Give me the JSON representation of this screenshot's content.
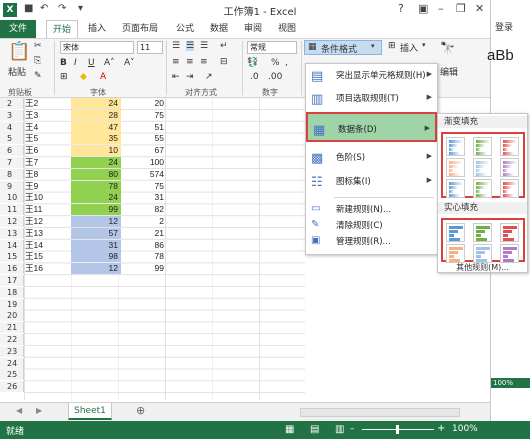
{
  "window": {
    "title": "工作簿1 - Excel",
    "help": "?",
    "login": "登录"
  },
  "ribbon_tabs": [
    "文件",
    "开始",
    "插入",
    "页面布局",
    "公式",
    "数据",
    "审阅",
    "视图"
  ],
  "ribbon": {
    "paste": "粘贴",
    "font_name": "宋体",
    "font_size": "11",
    "number_format": "常规",
    "conditional_format": "条件格式",
    "insert": "插入",
    "edit": "编辑",
    "style_preview": "aBb",
    "groups": {
      "clipboard": "剪贴板",
      "font": "字体",
      "alignment": "对齐方式",
      "number": "数字"
    }
  },
  "rows": [
    {
      "num": "2",
      "name": "王2",
      "b": "24",
      "c": "20"
    },
    {
      "num": "3",
      "name": "王3",
      "b": "28",
      "c": "75"
    },
    {
      "num": "4",
      "name": "王4",
      "b": "47",
      "c": "51"
    },
    {
      "num": "5",
      "name": "王5",
      "b": "35",
      "c": "55"
    },
    {
      "num": "6",
      "name": "王6",
      "b": "10",
      "c": "67"
    },
    {
      "num": "7",
      "name": "王7",
      "b": "24",
      "c": "100"
    },
    {
      "num": "8",
      "name": "王8",
      "b": "80",
      "c": "574"
    },
    {
      "num": "9",
      "name": "王9",
      "b": "78",
      "c": "75"
    },
    {
      "num": "10",
      "name": "王10",
      "b": "24",
      "c": "31"
    },
    {
      "num": "11",
      "name": "王11",
      "b": "99",
      "c": "82"
    },
    {
      "num": "12",
      "name": "王12",
      "b": "12",
      "c": "2"
    },
    {
      "num": "13",
      "name": "王13",
      "b": "57",
      "c": "21"
    },
    {
      "num": "14",
      "name": "王14",
      "b": "31",
      "c": "86"
    },
    {
      "num": "15",
      "name": "王15",
      "b": "98",
      "c": "78"
    },
    {
      "num": "16",
      "name": "王16",
      "b": "12",
      "c": "99"
    }
  ],
  "empty_rows": [
    "17",
    "18",
    "19",
    "20",
    "21",
    "22",
    "23",
    "24",
    "25",
    "26"
  ],
  "row_colors": {
    "yellow": "#ffe699",
    "green": "#92d050",
    "blue": "#b4c6e7"
  },
  "menu": {
    "items": [
      {
        "label": "突出显示单元格规则(H)",
        "icon": "highlight-rules-icon"
      },
      {
        "label": "项目选取规则(T)",
        "icon": "top-bottom-rules-icon"
      },
      {
        "label": "数据条(D)",
        "icon": "data-bars-icon"
      },
      {
        "label": "色阶(S)",
        "icon": "color-scales-icon"
      },
      {
        "label": "图标集(I)",
        "icon": "icon-sets-icon"
      },
      {
        "label": "新建规则(N)...",
        "icon": "new-rule-icon"
      },
      {
        "label": "清除规则(C)",
        "icon": "clear-rules-icon"
      },
      {
        "label": "管理规则(R)...",
        "icon": "manage-rules-icon"
      }
    ]
  },
  "submenu": {
    "gradient_fill": "渐变填充",
    "solid_fill": "实心填充",
    "more_rules": "其他规则(M)...",
    "bar_colors": [
      "#5b9bd5",
      "#70ad47",
      "#e05050",
      "#f4b183",
      "#9dc3e6",
      "#b07cc6"
    ]
  },
  "sheet": {
    "tab": "Sheet1"
  },
  "status": {
    "ready": "就绪",
    "zoom": "100%",
    "right_zoom": "100%"
  },
  "accent": "#217346"
}
